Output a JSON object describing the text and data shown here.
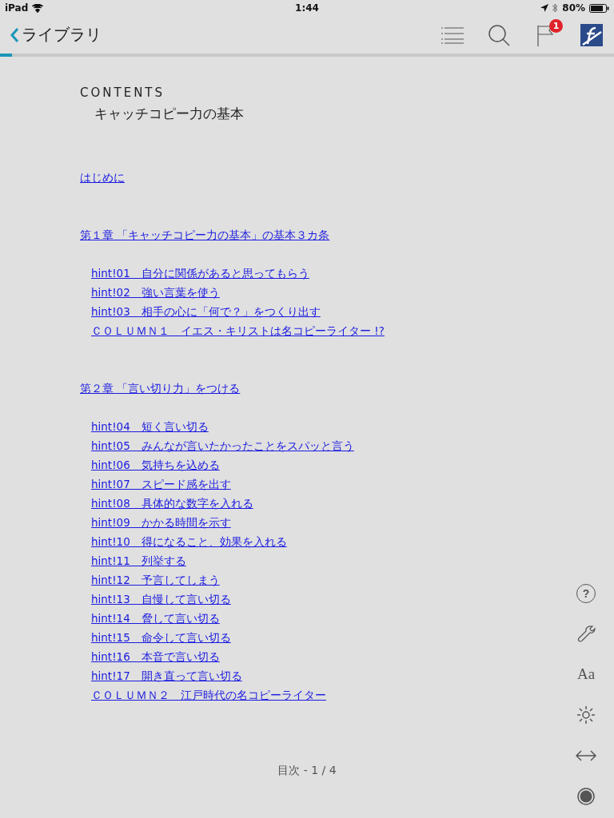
{
  "status_bar": {
    "device": "iPad",
    "time": "1:44",
    "battery": "80%"
  },
  "nav_bar": {
    "back": "ライブラリ",
    "flag_badge": "1"
  },
  "progress": {
    "level": 0.02
  },
  "toc": {
    "label": "CONTENTS",
    "title": "キャッチコピー力の基本",
    "groups": [
      {
        "heading": "はじめに"
      },
      {
        "heading": "第１章 「キャッチコピー力の基本」の基本３カ条",
        "entries": [
          "hint!01　自分に関係があると思ってもらう",
          "hint!02　強い言葉を使う",
          "hint!03　相手の心に「何で？」をつくり出す",
          "ＣＯＬＵＭＮ１　イエス・キリストは名コピーライター !?"
        ]
      },
      {
        "heading": "第２章 「言い切り力」をつける",
        "entries": [
          "hint!04　短く言い切る",
          "hint!05　みんなが言いたかったことをスパッと言う",
          "hint!06　気持ちを込める",
          "hint!07　スピード感を出す",
          "hint!08　具体的な数字を入れる",
          "hint!09　かかる時間を示す",
          "hint!10　得になること、効果を入れる",
          "hint!11　列挙する",
          "hint!12　予言してしまう",
          "hint!13　自慢して言い切る",
          "hint!14　脅して言い切る",
          "hint!15　命令して言い切る",
          "hint!16　本音で言い切る",
          "hint!17　開き直って言い切る",
          "ＣＯＬＵＭＮ２　江戸時代の名コピーライター"
        ]
      }
    ]
  },
  "tools": [
    {
      "kind": "help",
      "text": "?"
    },
    {
      "kind": "wrench"
    },
    {
      "kind": "font",
      "text": "Aa"
    },
    {
      "kind": "brightness"
    },
    {
      "kind": "width"
    },
    {
      "kind": "record"
    }
  ],
  "page_indicator": "目次 - 1 / 4"
}
